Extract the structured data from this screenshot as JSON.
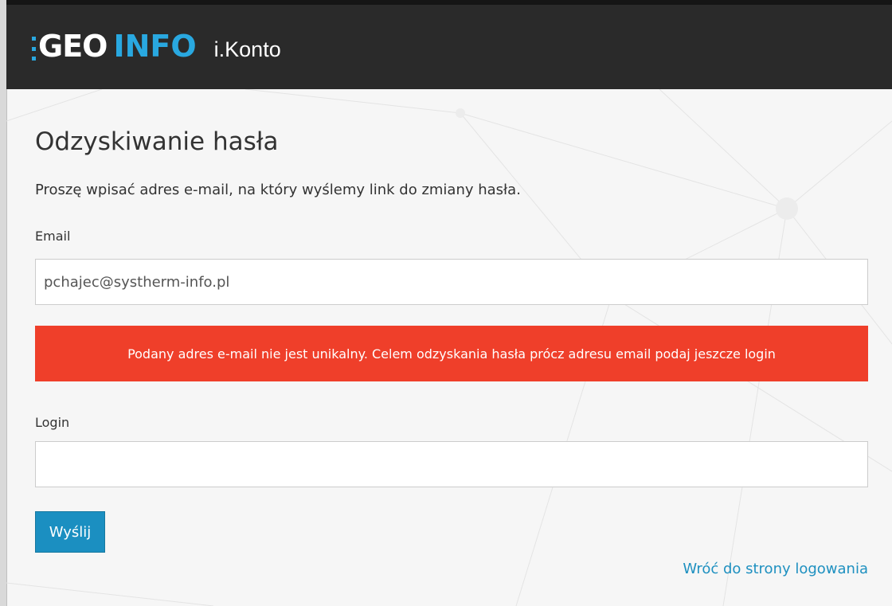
{
  "header": {
    "logo_geo": "GEO",
    "logo_info": "INFO",
    "app_name": "i.Konto"
  },
  "form": {
    "title": "Odzyskiwanie hasła",
    "intro": "Proszę wpisać adres e-mail, na który wyślemy link do zmiany hasła.",
    "email_label": "Email",
    "email_value": "pchajec@systherm-info.pl",
    "error_message": "Podany adres e-mail nie jest unikalny. Celem odzyskania hasła prócz adresu email podaj jeszcze login",
    "login_label": "Login",
    "login_value": "",
    "submit_label": "Wyślij",
    "back_link": "Wróć do strony logowania"
  },
  "colors": {
    "header_bg": "#2a2a2a",
    "brand_blue": "#29a8e0",
    "error_bg": "#ef3f2a",
    "button_bg": "#1b8fc1",
    "link": "#1e90c0"
  }
}
